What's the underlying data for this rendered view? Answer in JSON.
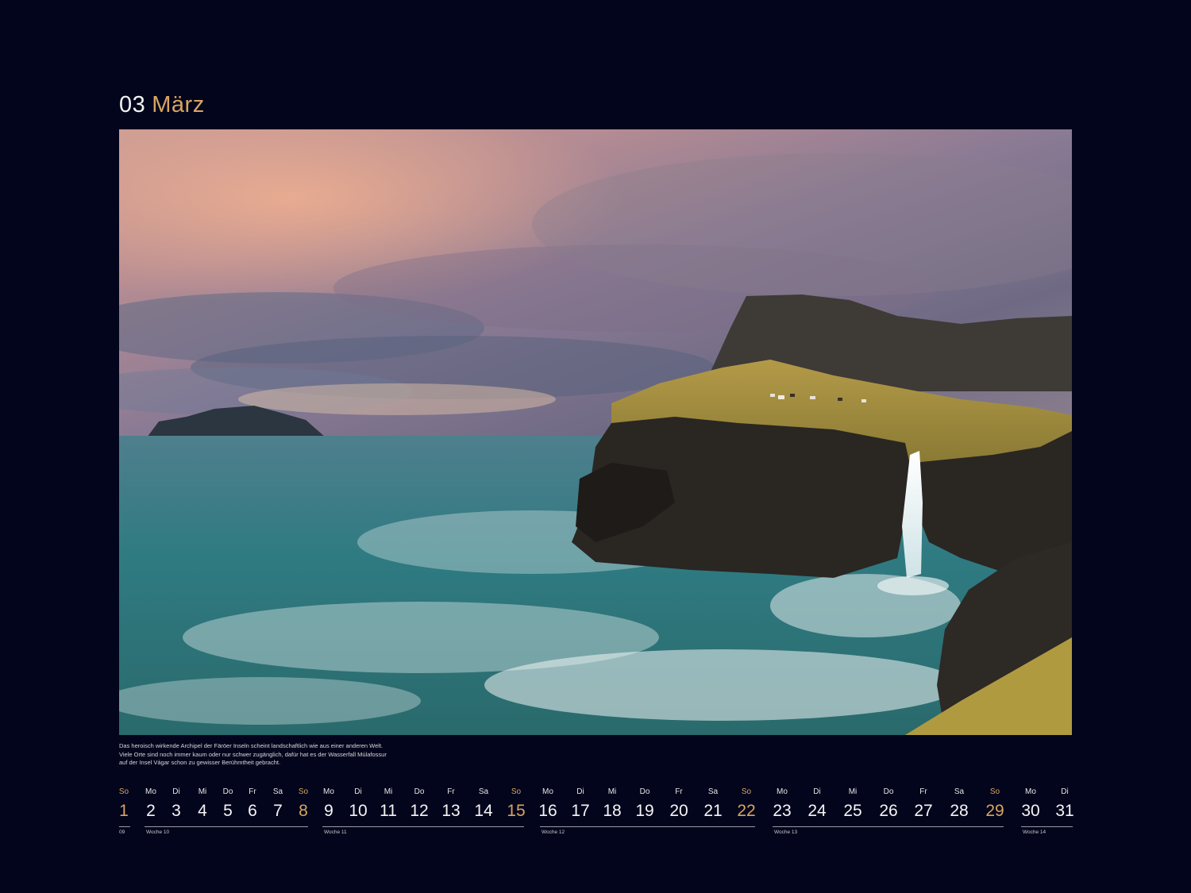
{
  "header": {
    "month_number": "03",
    "month_name": "März"
  },
  "photo": {
    "subject": "Mulafossur waterfall cliffs, Faroe Islands"
  },
  "caption": "Das heroisch wirkende Archipel der Färöer Inseln scheint landschaftlich wie aus einer anderen Welt. Viele Orte sind noch immer kaum oder nur schwer zugänglich, dafür hat es der Wasserfall Múlafossur auf der Insel Vágar schon zu gewisser Berühmtheit gebracht.",
  "calendar": {
    "days": [
      {
        "wd": "So",
        "d": "1",
        "sun": true
      },
      {
        "wd": "Mo",
        "d": "2"
      },
      {
        "wd": "Di",
        "d": "3"
      },
      {
        "wd": "Mi",
        "d": "4"
      },
      {
        "wd": "Do",
        "d": "5"
      },
      {
        "wd": "Fr",
        "d": "6"
      },
      {
        "wd": "Sa",
        "d": "7"
      },
      {
        "wd": "So",
        "d": "8",
        "sun": true
      },
      {
        "wd": "Mo",
        "d": "9"
      },
      {
        "wd": "Di",
        "d": "10"
      },
      {
        "wd": "Mi",
        "d": "11"
      },
      {
        "wd": "Do",
        "d": "12"
      },
      {
        "wd": "Fr",
        "d": "13"
      },
      {
        "wd": "Sa",
        "d": "14"
      },
      {
        "wd": "So",
        "d": "15",
        "sun": true
      },
      {
        "wd": "Mo",
        "d": "16"
      },
      {
        "wd": "Di",
        "d": "17"
      },
      {
        "wd": "Mi",
        "d": "18"
      },
      {
        "wd": "Do",
        "d": "19"
      },
      {
        "wd": "Fr",
        "d": "20"
      },
      {
        "wd": "Sa",
        "d": "21"
      },
      {
        "wd": "So",
        "d": "22",
        "sun": true
      },
      {
        "wd": "Mo",
        "d": "23"
      },
      {
        "wd": "Di",
        "d": "24"
      },
      {
        "wd": "Mi",
        "d": "25"
      },
      {
        "wd": "Do",
        "d": "26"
      },
      {
        "wd": "Fr",
        "d": "27"
      },
      {
        "wd": "Sa",
        "d": "28"
      },
      {
        "wd": "So",
        "d": "29",
        "sun": true
      },
      {
        "wd": "Mo",
        "d": "30"
      },
      {
        "wd": "Di",
        "d": "31"
      }
    ],
    "weeks": [
      "09",
      "Woche 10",
      "Woche 11",
      "Woche 12",
      "Woche 13",
      "Woche 14"
    ]
  },
  "colors": {
    "background": "#03051c",
    "accent": "#d9a561",
    "text": "#f2f2f2"
  }
}
